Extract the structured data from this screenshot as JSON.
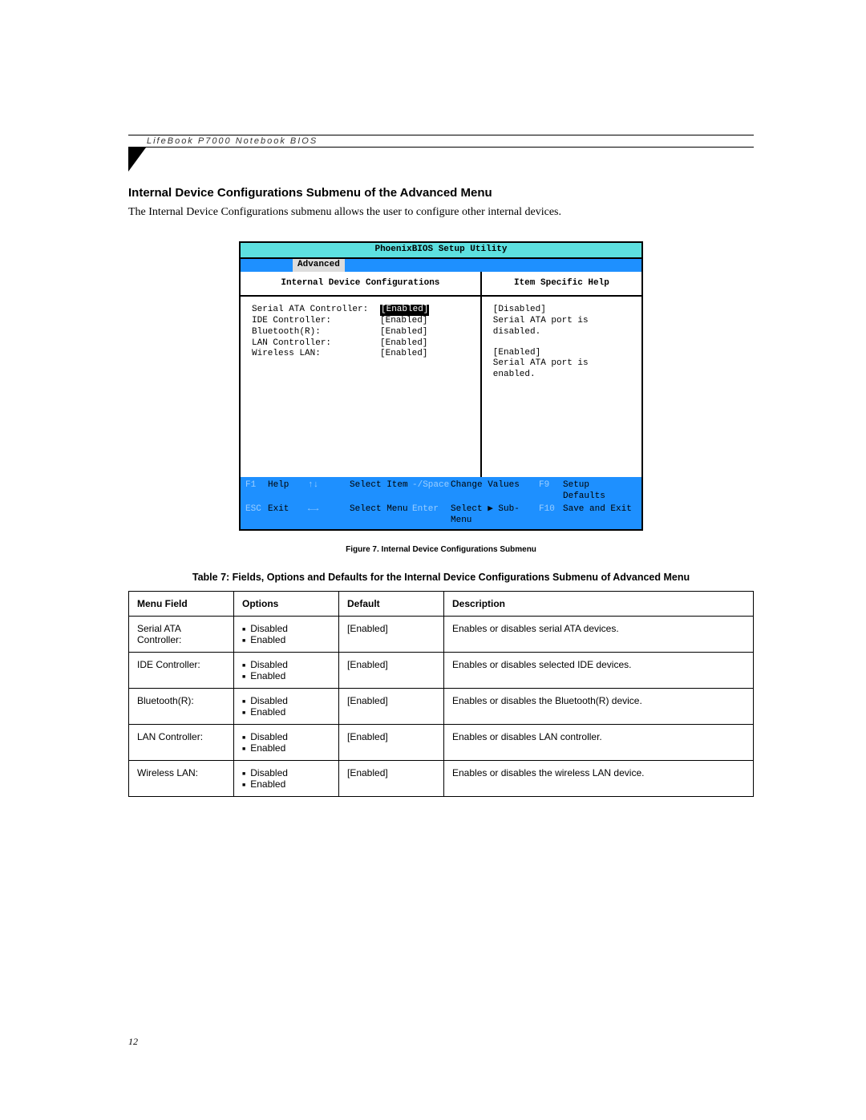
{
  "running_head": "LifeBook P7000 Notebook BIOS",
  "section_title": "Internal Device Configurations Submenu of the Advanced Menu",
  "intro_text": "The Internal Device Configurations submenu allows the user to configure other internal devices.",
  "bios": {
    "title": "PhoenixBIOS Setup Utility",
    "active_tab": "Advanced",
    "left_heading": "Internal Device Configurations",
    "right_heading": "Item Specific Help",
    "settings": [
      {
        "label": "Serial ATA Controller:",
        "value": "[Enabled]",
        "selected": true
      },
      {
        "label": "IDE Controller:",
        "value": "[Enabled]",
        "selected": false
      },
      {
        "label": "Bluetooth(R):",
        "value": "[Enabled]",
        "selected": false
      },
      {
        "label": "LAN Controller:",
        "value": "[Enabled]",
        "selected": false
      },
      {
        "label": "Wireless LAN:",
        "value": "[Enabled]",
        "selected": false
      }
    ],
    "help": {
      "block1_title": "[Disabled]",
      "block1_text": "Serial ATA port is disabled.",
      "block2_title": "[Enabled]",
      "block2_text": "Serial ATA port is enabled."
    },
    "footer": {
      "r1": {
        "k1": "F1",
        "t1": "Help",
        "k2": "↑↓",
        "t2": "Select Item",
        "k3": "-/Space",
        "t3": "Change Values",
        "k4": "F9",
        "t4": "Setup Defaults"
      },
      "r2": {
        "k1": "ESC",
        "t1": "Exit",
        "k2": "←→",
        "t2": "Select Menu",
        "k3": "Enter",
        "t3": "Select ▶ Sub-Menu",
        "k4": "F10",
        "t4": "Save and Exit"
      }
    }
  },
  "figure_caption": "Figure 7.   Internal Device Configurations Submenu",
  "table_title": "Table 7: Fields, Options and Defaults for the Internal Device Configurations Submenu of Advanced Menu",
  "table": {
    "headers": {
      "c1": "Menu Field",
      "c2": "Options",
      "c3": "Default",
      "c4": "Description"
    },
    "rows": [
      {
        "field": "Serial ATA Controller:",
        "opt1": "Disabled",
        "opt2": "Enabled",
        "def": "[Enabled]",
        "desc": "Enables or disables serial ATA devices."
      },
      {
        "field": "IDE Controller:",
        "opt1": "Disabled",
        "opt2": "Enabled",
        "def": "[Enabled]",
        "desc": "Enables or disables selected IDE devices."
      },
      {
        "field": "Bluetooth(R):",
        "opt1": "Disabled",
        "opt2": "Enabled",
        "def": "[Enabled]",
        "desc": "Enables or disables the Bluetooth(R) device."
      },
      {
        "field": "LAN Controller:",
        "opt1": "Disabled",
        "opt2": "Enabled",
        "def": "[Enabled]",
        "desc": "Enables or disables LAN controller."
      },
      {
        "field": "Wireless LAN:",
        "opt1": "Disabled",
        "opt2": "Enabled",
        "def": "[Enabled]",
        "desc": "Enables or disables the wireless LAN device."
      }
    ]
  },
  "page_number": "12"
}
